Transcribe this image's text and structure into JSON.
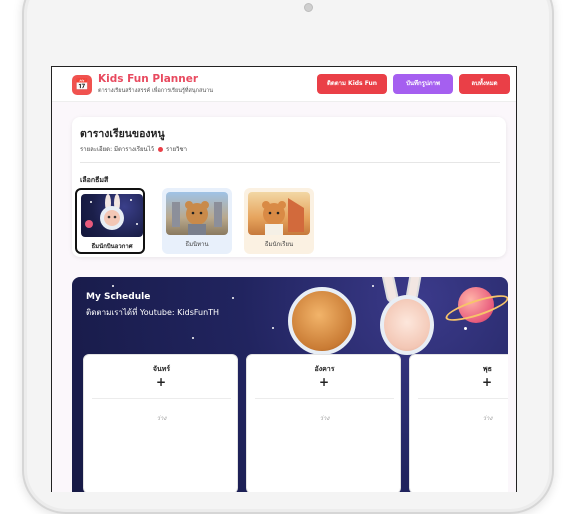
{
  "header": {
    "logo_glyph": "📅",
    "title": "Kids Fun Planner",
    "subtitle": "ตารางเรียนสร้างสรรค์ เพื่อการเรียนรู้ที่สนุกสนาน",
    "buttons": {
      "follow": "ติดตาม Kids Fun",
      "save_image": "บันทึกรูปภาพ",
      "clear_all": "ลบทั้งหมด"
    }
  },
  "info": {
    "title": "ตารางเรียนของหนู",
    "detail": "รายละเอียด: มีตารางเรียนไว้",
    "subject_count_label": "รายวิชา"
  },
  "themes": {
    "label": "เลือกธีมสี",
    "items": [
      {
        "label": "ธีมนักบินอวกาศ",
        "selected": true
      },
      {
        "label": "ธีมนิทาน",
        "selected": false
      },
      {
        "label": "ธีมนักเรียน",
        "selected": false
      }
    ]
  },
  "schedule": {
    "title": "My Schedule",
    "subtitle": "ติดตามเราได้ที่ Youtube: KidsFunTH",
    "days": [
      {
        "name": "จันทร์",
        "add": "+",
        "empty": "ว่าง"
      },
      {
        "name": "อังคาร",
        "add": "+",
        "empty": "ว่าง"
      },
      {
        "name": "พุธ",
        "add": "+",
        "empty": "ว่าง"
      }
    ]
  },
  "colors": {
    "brand_red": "#ea3f47",
    "accent_purple": "#a55ff0",
    "schedule_bg": "#21245f"
  }
}
